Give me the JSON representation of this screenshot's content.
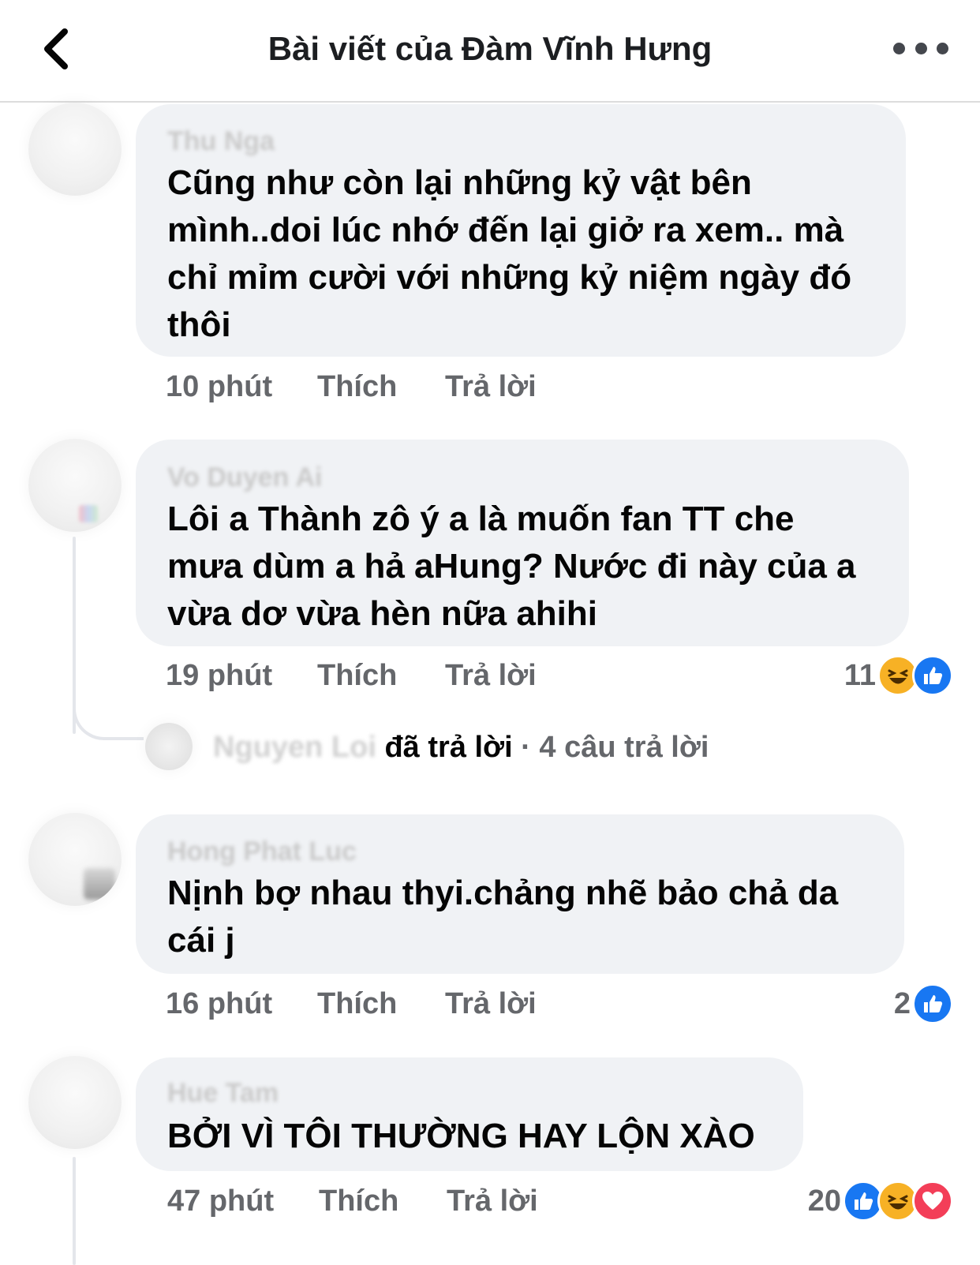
{
  "header": {
    "back_icon": "chevron-left-icon",
    "title": "Bài viết của Đàm Vĩnh Hưng",
    "more_icon": "more-dots-icon"
  },
  "comments": [
    {
      "author": "Thu Nga",
      "text": "Cũng như còn lại những kỷ vật bên\nmình..doi lúc nhớ đến lại giở ra xem.. mà\nchỉ mỉm cười với những kỷ niệm ngày đó\nthôi",
      "time": "10 phút",
      "like_label": "Thích",
      "reply_label": "Trả lời"
    },
    {
      "author": "Vo Duyen Ai",
      "text": "Lôi a Thành zô ý a là muốn fan TT che\nmưa dùm a hả aHung? Nước đi này của a\nvừa dơ vừa hèn nữa ahihi",
      "time": "19 phút",
      "like_label": "Thích",
      "reply_label": "Trả lời",
      "reaction_count": "11",
      "reactions": [
        "haha-icon",
        "like-icon"
      ],
      "reply_summary": {
        "name": "Nguyen Loi",
        "action": "đã trả lời",
        "separator": " · ",
        "count": "4 câu trả lời"
      }
    },
    {
      "author": "Hong Phat Luc",
      "text": "Nịnh bợ nhau thyi.chảng nhẽ bảo chả da\ncái j",
      "time": "16 phút",
      "like_label": "Thích",
      "reply_label": "Trả lời",
      "reaction_count": "2",
      "reactions": [
        "like-icon"
      ]
    },
    {
      "author": "Hue Tam",
      "text": "BỞI VÌ TÔI THƯỜNG HAY LỘN XÀO",
      "time": "47 phút",
      "like_label": "Thích",
      "reply_label": "Trả lời",
      "reaction_count": "20",
      "reactions": [
        "like-icon",
        "haha-icon",
        "love-icon"
      ]
    }
  ],
  "colors": {
    "bubble": "#f0f2f5",
    "meta_text": "#65676b",
    "like_blue": "#1877f2",
    "haha_yellow": "#f7b125",
    "love_red": "#f33e58"
  }
}
